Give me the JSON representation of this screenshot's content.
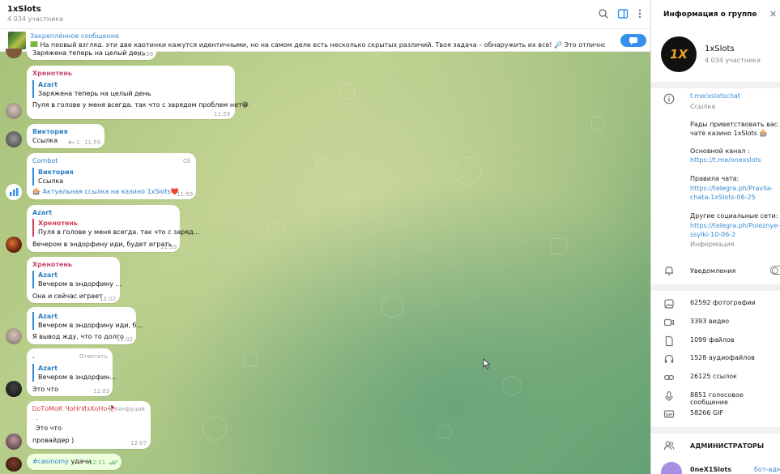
{
  "chat": {
    "title": "1xSlots",
    "subtitle": "4 034 участника"
  },
  "pinned": {
    "label": "Закреплённое сообщение",
    "text": "🟩 На первый взгляд, эти две картинки кажутся идентичными, но на самом деле есть несколько скрытых различий. Твоя задача – обнаружить их все! 🔎 Это отличное упражнение для 🧠"
  },
  "messages": [
    {
      "text": "Заряжена теперь на целый день",
      "time": "11:58"
    },
    {
      "sender": "Хренотень",
      "quote_name": "Azart",
      "quote_text": "Заряжена теперь на целый день",
      "text": "Пуля в голове у меня всегда. так что с зарядом проблем нет😁",
      "time": "11:59"
    },
    {
      "sender": "Виктория",
      "text": "Ссылка",
      "replies": "1",
      "time": "11:59"
    },
    {
      "sender": "Combot",
      "badge": "Сб",
      "quote_name": "Виктория",
      "quote_text": "Ссылка",
      "text": "🎰 Актуальная ссылка на казино 1xSlots❤️",
      "time": "11:59"
    },
    {
      "sender": "Azart",
      "quote_name": "Хренотень",
      "quote_text": "Пуля в голове у меня всегда. так что с заряд...",
      "text": "Вечером в эндорфину иди, будет играть",
      "time": "11:59"
    },
    {
      "sender": "Хренотень",
      "quote_name": "Azart",
      "quote_text": "Вечером в эндорфину ...",
      "text": "Она и сейчас играет",
      "time": "12:02"
    },
    {
      "quote_name": "Azart",
      "quote_text": "Вечером в эндорфину иди, б...",
      "text": "Я вывод жду, что то долго",
      "time": "12:02"
    },
    {
      "sender": ".",
      "reply_label": "Ответить",
      "quote_name": "Azart",
      "quote_text": "Вечером в эндорфин...",
      "text": "Это что",
      "time": "12:03"
    },
    {
      "sender": "ᎠоТоМоК ЧоНгИзХоНо🥀",
      "badge": "Конфуций",
      "text1": ".",
      "text2": "Это что",
      "text3": "провайдер )",
      "time": "12:07"
    },
    {
      "hashtag": "#casinomy",
      "text": "удачи",
      "time": "12:11"
    }
  ],
  "panel": {
    "title": "Информация о группе",
    "group_name": "1xSlots",
    "group_members": "4 034 участника",
    "avatar_text": "1X",
    "link": "t.me/xslotschat",
    "link_caption": "Ссылка",
    "info_lines": [
      "Рады приветствовать вас в",
      "чате казино 1xSlots 🎰"
    ],
    "main_channel_label": "Основной канал :",
    "main_channel_link": "https://t.me/onexslots",
    "rules_label": "Правила чата:",
    "rules_link1": "https://telegra.ph/Pravila-",
    "rules_link2": "chata-1xSlots-06-25",
    "social_label": "Другие социальные сети:",
    "social_link1": "https://telegra.ph/Poleznye-",
    "social_link2": "ssylki-10-06-2",
    "info_caption": "Информация",
    "notifications": "Уведомления",
    "media": [
      {
        "icon": "photo-icon",
        "label": "62592 фотографии"
      },
      {
        "icon": "video-icon",
        "label": "3393 видео"
      },
      {
        "icon": "file-icon",
        "label": "1099 файлов"
      },
      {
        "icon": "headphones-icon",
        "label": "1528 аудиофайлов"
      },
      {
        "icon": "link-icon",
        "label": "26125 ссылок"
      },
      {
        "icon": "microphone-icon",
        "label": "8851 голосовое сообщение"
      },
      {
        "icon": "gif-icon",
        "label": "58266 GIF"
      }
    ],
    "admins_label": "АДМИНИСТРАТОРЫ",
    "admin_name": "0neX1Slots",
    "admin_role": "бот-адми"
  },
  "colors": {
    "accent": "#3390ec",
    "link": "#3a8bd0"
  }
}
